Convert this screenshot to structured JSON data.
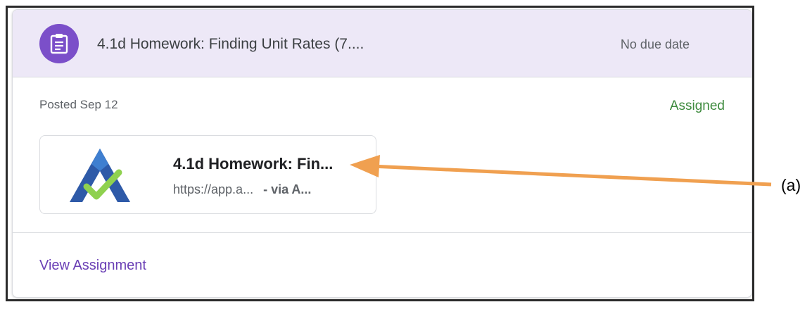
{
  "assignment": {
    "title": "4.1d Homework: Finding Unit Rates (7....",
    "due": "No due date",
    "icon": "assignment-clipboard-icon",
    "accent_color": "#7b4fc9"
  },
  "details": {
    "posted": "Posted Sep 12",
    "status": "Assigned",
    "status_color": "#3d8a3d"
  },
  "attachment": {
    "title": "4.1d Homework: Fin...",
    "url": "https://app.a...",
    "via": "- via A...",
    "thumbnail_icon": "app-logo-checkmark-icon"
  },
  "footer": {
    "view_label": "View Assignment"
  },
  "annotation": {
    "label": "(a)",
    "arrow_color": "#f0a050"
  }
}
